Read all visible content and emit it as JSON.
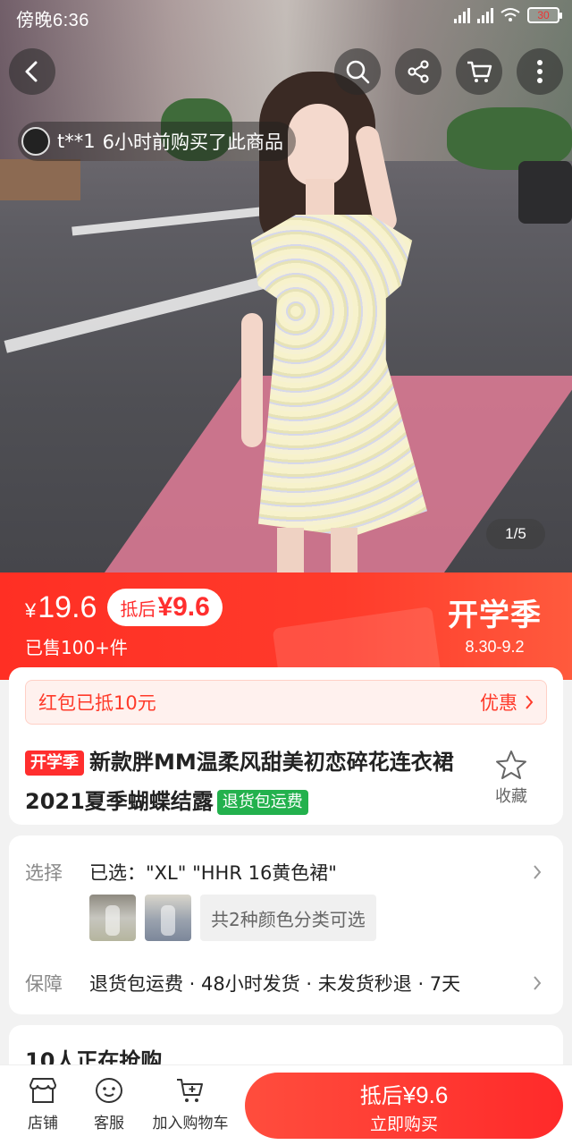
{
  "status_bar": {
    "time": "傍晚6:36",
    "battery": "30"
  },
  "hero": {
    "buyer_name": "t**1",
    "buyer_text": "6小时前购买了此商品",
    "page_indicator": "1/5"
  },
  "price": {
    "currency": "¥",
    "current": "19.6",
    "after_label": "抵后",
    "after_value": "¥9.6",
    "sold": "已售100+件",
    "promo_title": "开学季",
    "promo_dates": "8.30-9.2"
  },
  "coupon": {
    "left": "红包已抵10元",
    "right": "优惠"
  },
  "product": {
    "tag": "开学季",
    "title": "新款胖MM温柔风甜美初恋碎花连衣裙2021夏季蝴蝶结露",
    "shipping_tag": "退货包运费",
    "favorite_label": "收藏"
  },
  "options": {
    "select_label": "选择",
    "selected_text": "已选：\"XL\"  \"HHR 16黄色裙\"",
    "colors_text": "共2种颜色分类可选",
    "guarantee_label": "保障",
    "guarantee_text": "退货包运费 · 48小时发货 · 未发货秒退 · 7天"
  },
  "grabbing": {
    "title": "10人正在抢购"
  },
  "bottom_bar": {
    "shop": "店铺",
    "service": "客服",
    "cart": "加入购物车",
    "buy_top_label": "抵后",
    "buy_top_value": "¥9.6",
    "buy_bottom": "立即购买"
  },
  "colors": {
    "accent": "#ff2e2e",
    "green_tag": "#23b14d"
  }
}
